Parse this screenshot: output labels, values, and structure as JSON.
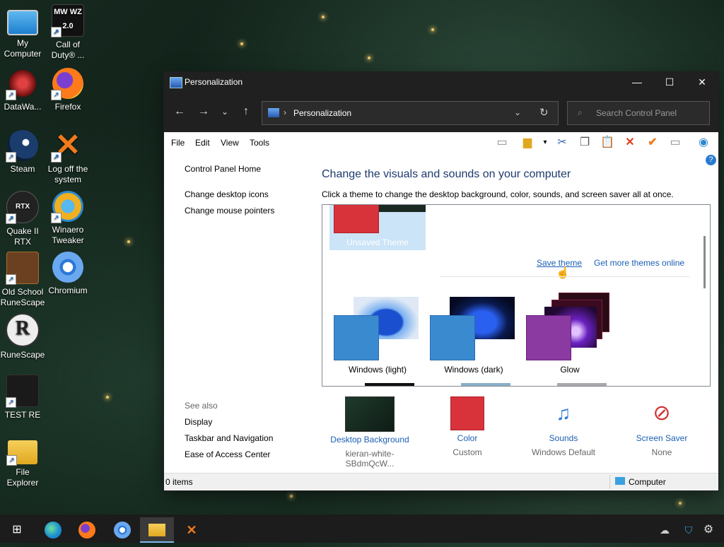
{
  "desktop": {
    "icons": [
      {
        "label": "My Computer"
      },
      {
        "label": "Call of Duty® ..."
      },
      {
        "label": "DataWa..."
      },
      {
        "label": "Firefox"
      },
      {
        "label": "Steam"
      },
      {
        "label": "Log off the system"
      },
      {
        "label": "Quake II RTX"
      },
      {
        "label": "Winaero Tweaker"
      },
      {
        "label": "Old School RuneScape"
      },
      {
        "label": "Chromium"
      },
      {
        "label": "RuneScape"
      },
      {
        "label": "TEST RE"
      },
      {
        "label": "File Explorer"
      }
    ],
    "cod_badge": "MW WZ 2.0",
    "rtx_badge": "RTX"
  },
  "window": {
    "title": "Personalization",
    "address": "Personalization",
    "search_placeholder": "Search Control Panel",
    "menu": [
      "File",
      "Edit",
      "View",
      "Tools"
    ],
    "left_links": [
      "Control Panel Home",
      "Change desktop icons",
      "Change mouse pointers"
    ],
    "see_also_label": "See also",
    "see_also": [
      "Display",
      "Taskbar and Navigation",
      "Ease of Access Center"
    ],
    "heading": "Change the visuals and sounds on your computer",
    "subtext": "Click a theme to change the desktop background, color, sounds, and screen saver all at once.",
    "unsaved_theme": "Unsaved Theme",
    "save_theme": "Save theme",
    "more_themes": "Get more themes online",
    "themes": [
      "Windows (light)",
      "Windows (dark)",
      "Glow"
    ],
    "bottom": [
      {
        "title": "Desktop Background",
        "sub": "kieran-white-SBdmQcW..."
      },
      {
        "title": "Color",
        "sub": "Custom"
      },
      {
        "title": "Sounds",
        "sub": "Windows Default"
      },
      {
        "title": "Screen Saver",
        "sub": "None"
      }
    ],
    "status_items": "0 items",
    "status_computer": "Computer"
  },
  "colors": {
    "accent_red": "#d8323b",
    "link_blue": "#1a5fb4",
    "heading_blue": "#1e3a6e",
    "titlebar": "#202020"
  }
}
